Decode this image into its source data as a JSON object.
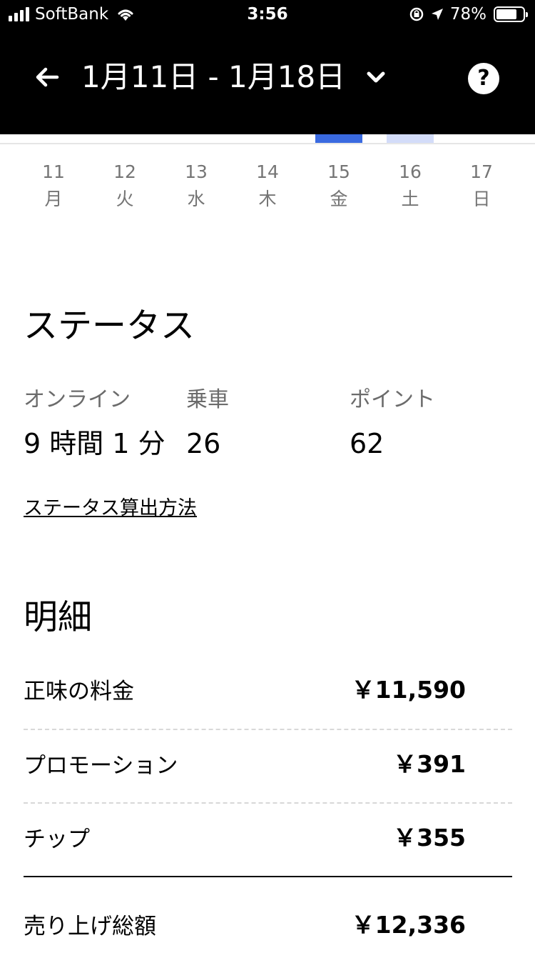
{
  "status_bar": {
    "carrier": "SoftBank",
    "time": "3:56",
    "battery_pct": "78%",
    "battery_level": 0.78
  },
  "header": {
    "date_range": "1月11日 - 1月18日",
    "help_label": "?"
  },
  "days": [
    {
      "num": "11",
      "dow": "月"
    },
    {
      "num": "12",
      "dow": "火"
    },
    {
      "num": "13",
      "dow": "水"
    },
    {
      "num": "14",
      "dow": "木"
    },
    {
      "num": "15",
      "dow": "金"
    },
    {
      "num": "16",
      "dow": "土"
    },
    {
      "num": "17",
      "dow": "日"
    }
  ],
  "colors": {
    "selected_bar": "#3a6ae0",
    "partial_bar": "#d3dcf9"
  },
  "status": {
    "title": "ステータス",
    "online_label": "オンライン",
    "online_value": "9 時間 1 分",
    "rides_label": "乗車",
    "rides_value": "26",
    "points_label": "ポイント",
    "points_value": "62",
    "method_link": "ステータス算出方法"
  },
  "breakdown": {
    "title": "明細",
    "rows": [
      {
        "label": "正味の料金",
        "value": "￥11,590"
      },
      {
        "label": "プロモーション",
        "value": "￥391"
      },
      {
        "label": "チップ",
        "value": "￥355"
      }
    ],
    "total_label": "売り上げ総額",
    "total_value": "￥12,336"
  }
}
